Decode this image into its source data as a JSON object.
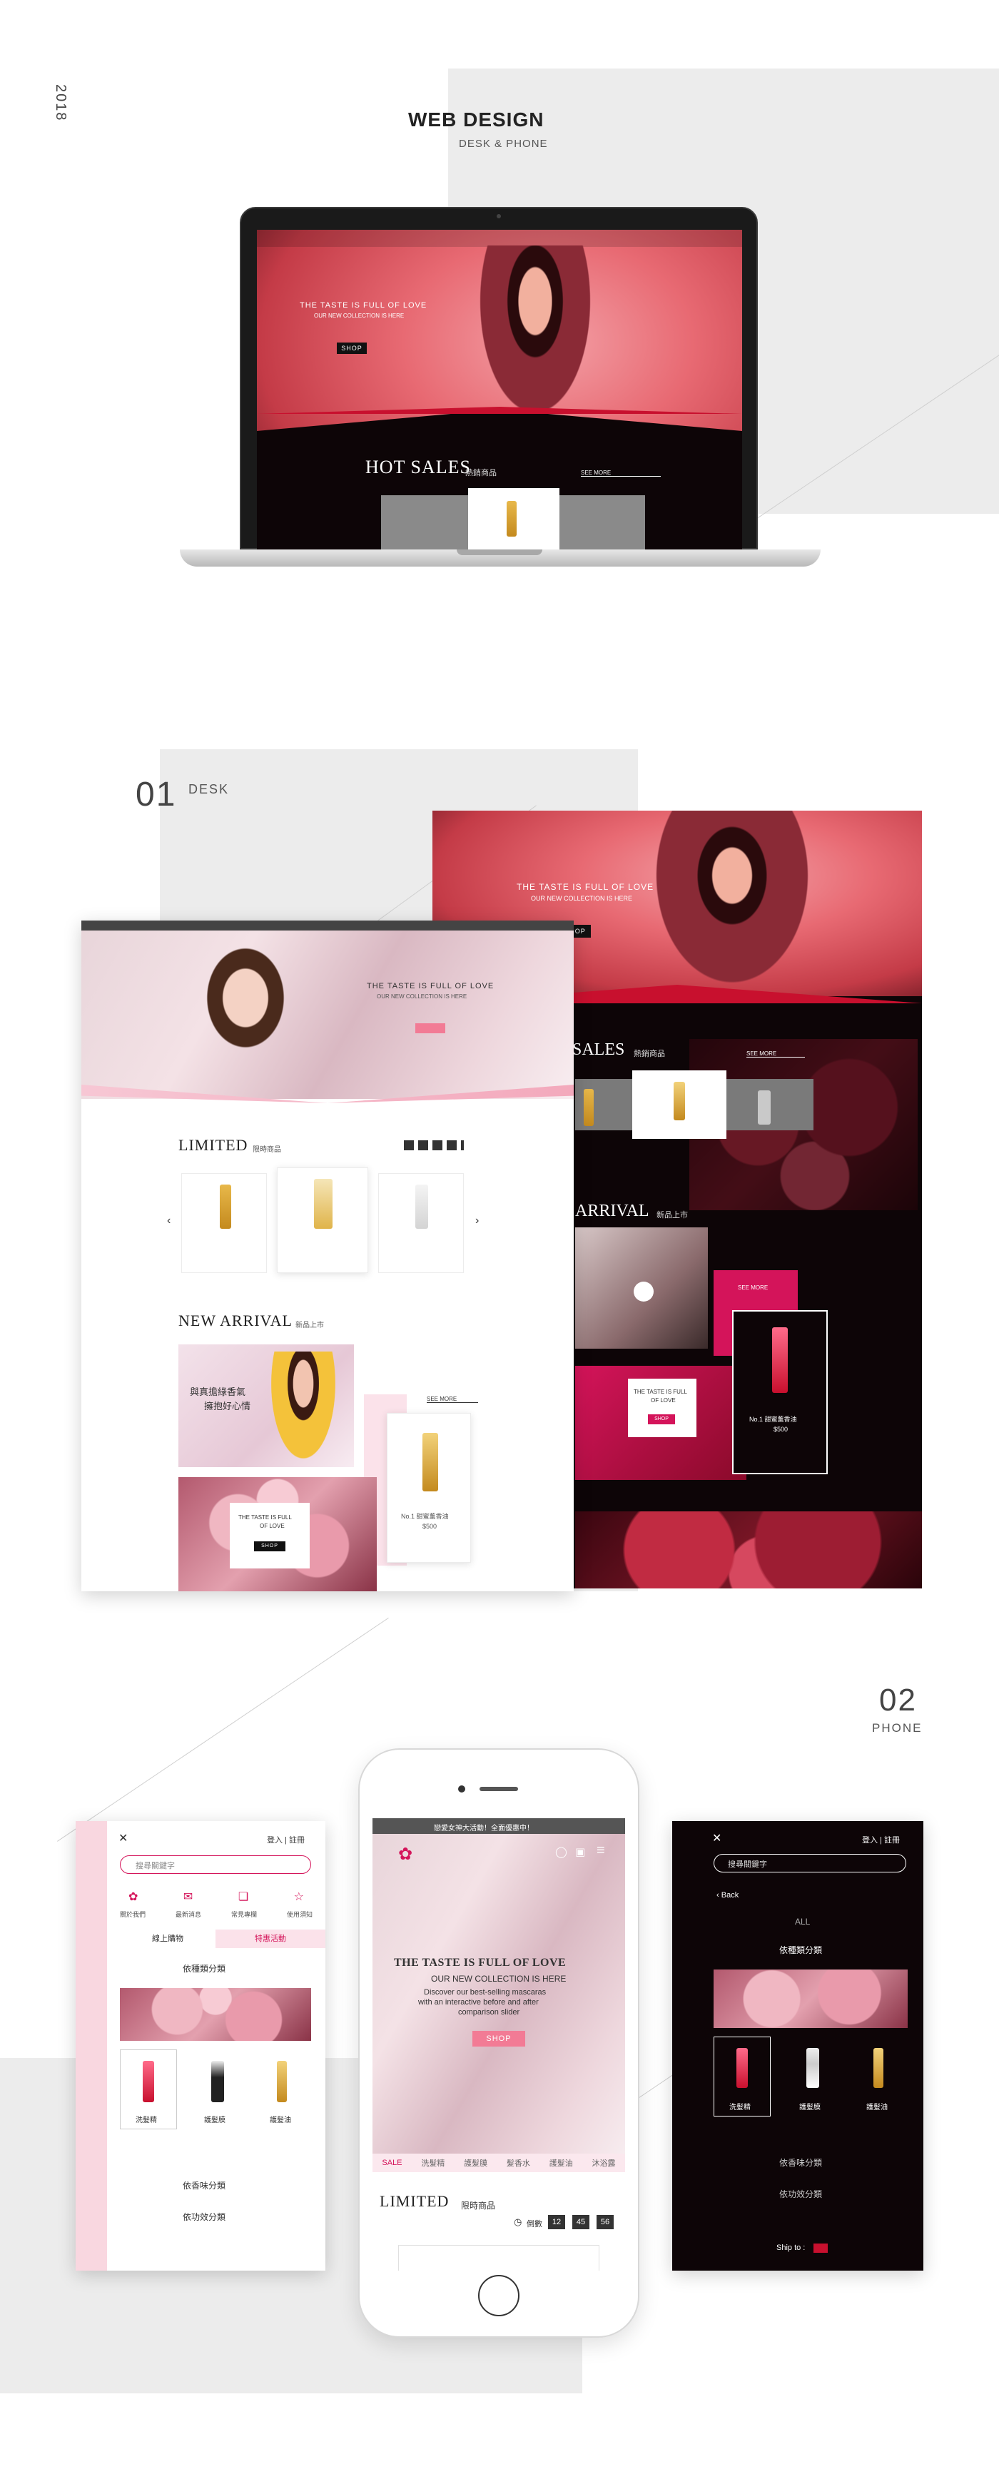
{
  "header": {
    "year": "2018",
    "title": "WEB DESIGN",
    "subtitle": "DESK & PHONE"
  },
  "laptop": {
    "hero_line1": "THE TASTE IS FULL OF LOVE",
    "hero_line2": "OUR NEW COLLECTION IS HERE",
    "shop": "SHOP",
    "hot_sales": "HOT SALES",
    "hot_sales_cn": "熱銷商品",
    "see_more": "SEE MORE"
  },
  "section_desk": {
    "number": "01",
    "label": "DESK"
  },
  "desk_light": {
    "hero_line1": "THE TASTE IS FULL OF LOVE",
    "hero_line2": "OUR NEW COLLECTION IS HERE",
    "limited": "LIMITED",
    "limited_cn": "限時商品",
    "new_arrival": "NEW ARRIVAL",
    "new_arrival_cn": "新品上市",
    "promo_line1": "與真擔綠香氣",
    "promo_line2": "擁抱好心情",
    "see_more": "SEE MORE",
    "card_line1": "THE TASTE IS FULL",
    "card_line2": "OF LOVE",
    "shop": "SHOP",
    "product_name": "No.1 甜蜜薰香油",
    "product_price": "$500"
  },
  "desk_dark": {
    "hero_line1": "THE TASTE IS FULL OF LOVE",
    "hero_line2": "OUR NEW COLLECTION IS HERE",
    "shop": "SHOP",
    "sales": "SALES",
    "sales_cn": "熱銷商品",
    "see_more": "SEE MORE",
    "arrival": "ARRIVAL",
    "arrival_cn": "新品上市",
    "see_more2": "SEE MORE",
    "card_line1": "THE TASTE IS FULL",
    "card_line2": "OF LOVE",
    "card_shop": "SHOP",
    "product_name": "No.1 甜蜜薰香油",
    "product_price": "$500"
  },
  "section_phone": {
    "number": "02",
    "label": "PHONE"
  },
  "phone_left": {
    "login": "登入 | 註冊",
    "search_placeholder": "搜尋關鍵字",
    "icons": [
      "關於我們",
      "最新消息",
      "常見專欄",
      "使用須知"
    ],
    "tab_online": "線上購物",
    "tab_event": "特惠活動",
    "category_type": "依種類分類",
    "products": [
      "洗髮精",
      "護髮膜",
      "護髮油"
    ],
    "category_scent": "依香味分類",
    "category_effect": "依功效分類"
  },
  "phone_center": {
    "top_banner": "戀愛女神大活動！全面優惠中！",
    "hero_line1": "THE TASTE IS FULL OF LOVE",
    "hero_line2": "OUR NEW COLLECTION IS HERE",
    "hero_line3": "Discover our best-selling mascaras",
    "hero_line4": "with an interactive before and after",
    "hero_line5": "comparison slider",
    "shop": "SHOP",
    "nav": [
      "SALE",
      "洗髮精",
      "護髮膜",
      "髮香水",
      "護髮油",
      "沐浴露"
    ],
    "limited": "LIMITED",
    "limited_cn": "限時商品",
    "countdown_label": "倒數",
    "countdown": [
      "12",
      "45",
      "56"
    ]
  },
  "phone_right": {
    "login": "登入 | 註冊",
    "search_placeholder": "搜尋關鍵字",
    "back": "Back",
    "all": "ALL",
    "category_type": "依種類分類",
    "products": [
      "洗髮精",
      "護髮膜",
      "護髮油"
    ],
    "category_scent": "依香味分類",
    "category_effect": "依功效分類",
    "ship_to": "Ship to :"
  },
  "colors": {
    "accent_pink": "#f27b95",
    "dark_bg": "#0d0507",
    "brand_red": "#c8102e"
  }
}
